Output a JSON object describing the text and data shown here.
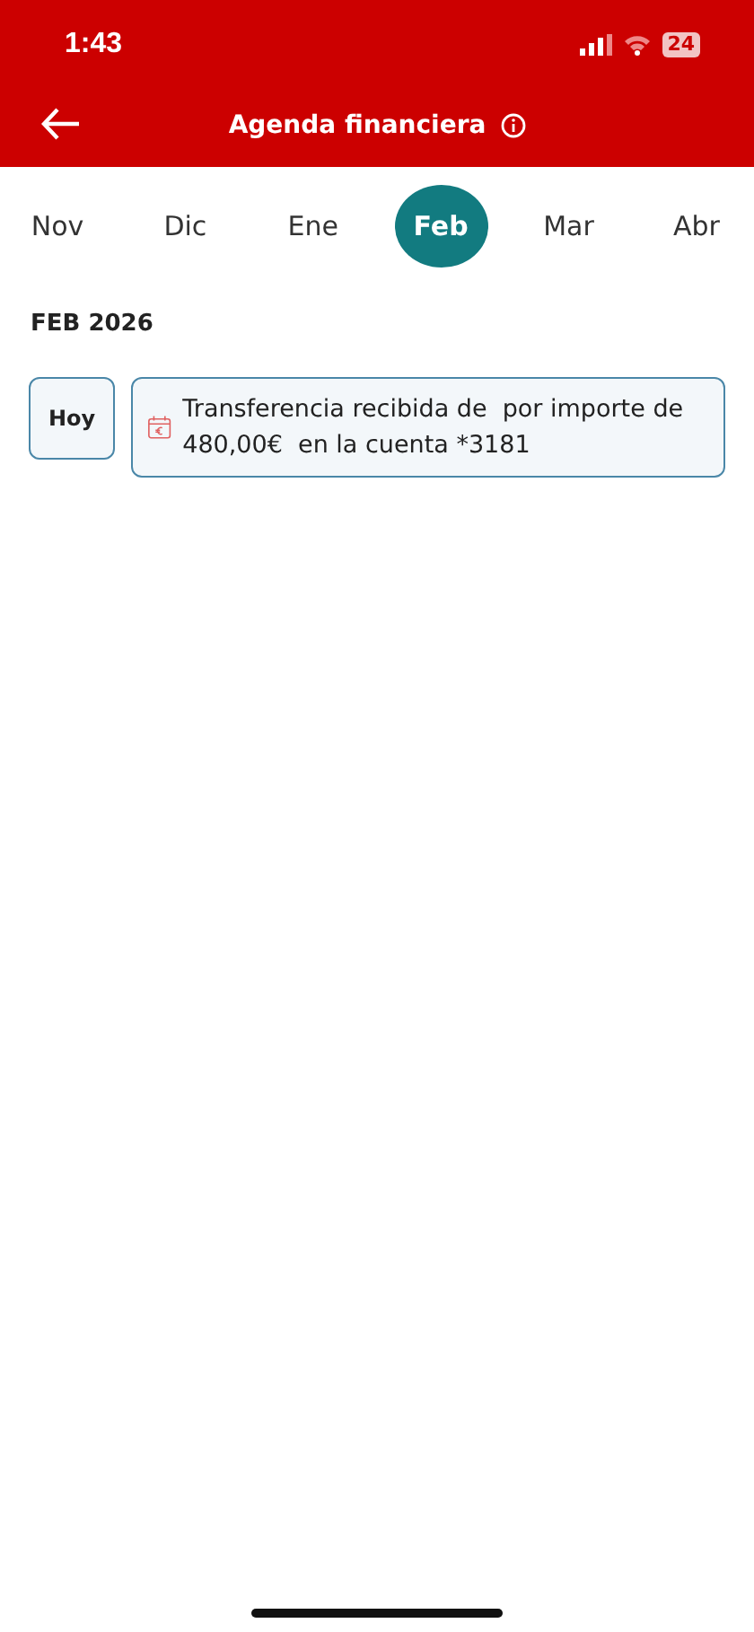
{
  "status_bar": {
    "time": "1:43",
    "battery": "24"
  },
  "header": {
    "title": "Agenda financiera"
  },
  "months": [
    {
      "label": "Nov",
      "selected": false
    },
    {
      "label": "Dic",
      "selected": false
    },
    {
      "label": "Ene",
      "selected": false
    },
    {
      "label": "Feb",
      "selected": true
    },
    {
      "label": "Mar",
      "selected": false
    },
    {
      "label": "Abr",
      "selected": false
    }
  ],
  "section": {
    "title": "FEB 2026"
  },
  "events": [
    {
      "day": "Hoy",
      "text": "Transferencia recibida de  por importe de 480,00€  en la cuenta *3181"
    }
  ]
}
